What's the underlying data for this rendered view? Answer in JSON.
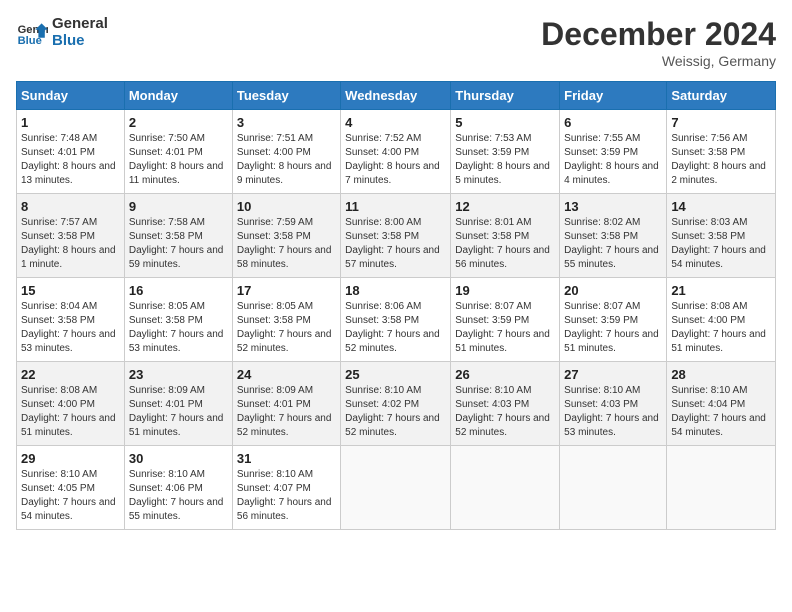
{
  "logo": {
    "text_general": "General",
    "text_blue": "Blue"
  },
  "title": "December 2024",
  "location": "Weissig, Germany",
  "days_of_week": [
    "Sunday",
    "Monday",
    "Tuesday",
    "Wednesday",
    "Thursday",
    "Friday",
    "Saturday"
  ],
  "weeks": [
    [
      {
        "day": 1,
        "sunrise": "7:48 AM",
        "sunset": "4:01 PM",
        "daylight": "8 hours and 13 minutes."
      },
      {
        "day": 2,
        "sunrise": "7:50 AM",
        "sunset": "4:01 PM",
        "daylight": "8 hours and 11 minutes."
      },
      {
        "day": 3,
        "sunrise": "7:51 AM",
        "sunset": "4:00 PM",
        "daylight": "8 hours and 9 minutes."
      },
      {
        "day": 4,
        "sunrise": "7:52 AM",
        "sunset": "4:00 PM",
        "daylight": "8 hours and 7 minutes."
      },
      {
        "day": 5,
        "sunrise": "7:53 AM",
        "sunset": "3:59 PM",
        "daylight": "8 hours and 5 minutes."
      },
      {
        "day": 6,
        "sunrise": "7:55 AM",
        "sunset": "3:59 PM",
        "daylight": "8 hours and 4 minutes."
      },
      {
        "day": 7,
        "sunrise": "7:56 AM",
        "sunset": "3:58 PM",
        "daylight": "8 hours and 2 minutes."
      }
    ],
    [
      {
        "day": 8,
        "sunrise": "7:57 AM",
        "sunset": "3:58 PM",
        "daylight": "8 hours and 1 minute."
      },
      {
        "day": 9,
        "sunrise": "7:58 AM",
        "sunset": "3:58 PM",
        "daylight": "7 hours and 59 minutes."
      },
      {
        "day": 10,
        "sunrise": "7:59 AM",
        "sunset": "3:58 PM",
        "daylight": "7 hours and 58 minutes."
      },
      {
        "day": 11,
        "sunrise": "8:00 AM",
        "sunset": "3:58 PM",
        "daylight": "7 hours and 57 minutes."
      },
      {
        "day": 12,
        "sunrise": "8:01 AM",
        "sunset": "3:58 PM",
        "daylight": "7 hours and 56 minutes."
      },
      {
        "day": 13,
        "sunrise": "8:02 AM",
        "sunset": "3:58 PM",
        "daylight": "7 hours and 55 minutes."
      },
      {
        "day": 14,
        "sunrise": "8:03 AM",
        "sunset": "3:58 PM",
        "daylight": "7 hours and 54 minutes."
      }
    ],
    [
      {
        "day": 15,
        "sunrise": "8:04 AM",
        "sunset": "3:58 PM",
        "daylight": "7 hours and 53 minutes."
      },
      {
        "day": 16,
        "sunrise": "8:05 AM",
        "sunset": "3:58 PM",
        "daylight": "7 hours and 53 minutes."
      },
      {
        "day": 17,
        "sunrise": "8:05 AM",
        "sunset": "3:58 PM",
        "daylight": "7 hours and 52 minutes."
      },
      {
        "day": 18,
        "sunrise": "8:06 AM",
        "sunset": "3:58 PM",
        "daylight": "7 hours and 52 minutes."
      },
      {
        "day": 19,
        "sunrise": "8:07 AM",
        "sunset": "3:59 PM",
        "daylight": "7 hours and 51 minutes."
      },
      {
        "day": 20,
        "sunrise": "8:07 AM",
        "sunset": "3:59 PM",
        "daylight": "7 hours and 51 minutes."
      },
      {
        "day": 21,
        "sunrise": "8:08 AM",
        "sunset": "4:00 PM",
        "daylight": "7 hours and 51 minutes."
      }
    ],
    [
      {
        "day": 22,
        "sunrise": "8:08 AM",
        "sunset": "4:00 PM",
        "daylight": "7 hours and 51 minutes."
      },
      {
        "day": 23,
        "sunrise": "8:09 AM",
        "sunset": "4:01 PM",
        "daylight": "7 hours and 51 minutes."
      },
      {
        "day": 24,
        "sunrise": "8:09 AM",
        "sunset": "4:01 PM",
        "daylight": "7 hours and 52 minutes."
      },
      {
        "day": 25,
        "sunrise": "8:10 AM",
        "sunset": "4:02 PM",
        "daylight": "7 hours and 52 minutes."
      },
      {
        "day": 26,
        "sunrise": "8:10 AM",
        "sunset": "4:03 PM",
        "daylight": "7 hours and 52 minutes."
      },
      {
        "day": 27,
        "sunrise": "8:10 AM",
        "sunset": "4:03 PM",
        "daylight": "7 hours and 53 minutes."
      },
      {
        "day": 28,
        "sunrise": "8:10 AM",
        "sunset": "4:04 PM",
        "daylight": "7 hours and 54 minutes."
      }
    ],
    [
      {
        "day": 29,
        "sunrise": "8:10 AM",
        "sunset": "4:05 PM",
        "daylight": "7 hours and 54 minutes."
      },
      {
        "day": 30,
        "sunrise": "8:10 AM",
        "sunset": "4:06 PM",
        "daylight": "7 hours and 55 minutes."
      },
      {
        "day": 31,
        "sunrise": "8:10 AM",
        "sunset": "4:07 PM",
        "daylight": "7 hours and 56 minutes."
      },
      null,
      null,
      null,
      null
    ]
  ]
}
